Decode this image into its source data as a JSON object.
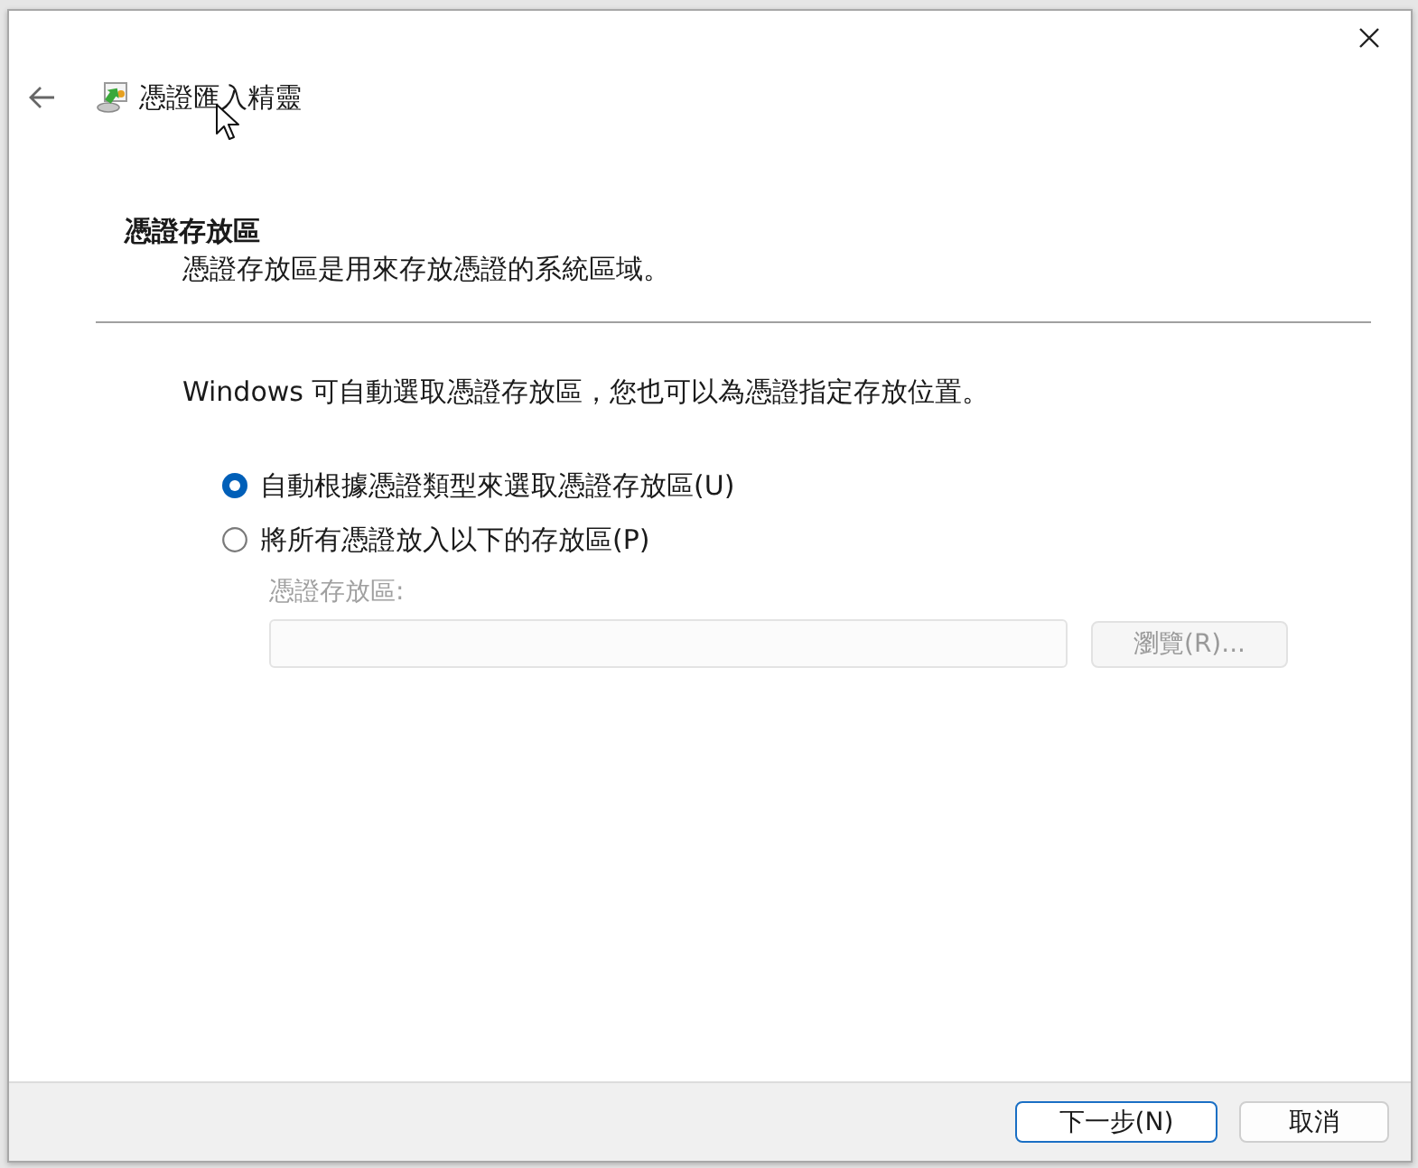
{
  "window": {
    "title": "憑證匯入精靈"
  },
  "header": {
    "title": "憑證存放區",
    "description": "憑證存放區是用來存放憑證的系統區域。"
  },
  "intro": "Windows 可自動選取憑證存放區，您也可以為憑證指定存放位置。",
  "options": [
    {
      "label": "自動根據憑證類型來選取憑證存放區(U)",
      "selected": true
    },
    {
      "label": "將所有憑證放入以下的存放區(P)",
      "selected": false
    }
  ],
  "store_field": {
    "label": "憑證存放區:",
    "disabled": true
  },
  "browse_button": {
    "label": "瀏覽(R)...",
    "disabled": true
  },
  "buttons": [
    {
      "label": "下一步(N)",
      "default": true
    },
    {
      "label": "取消",
      "default": false
    }
  ]
}
